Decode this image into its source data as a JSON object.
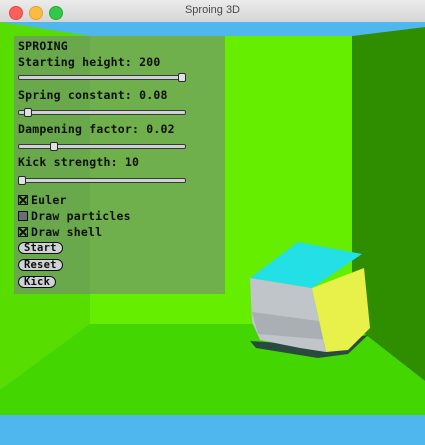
{
  "window": {
    "title": "Sproing 3D"
  },
  "panel": {
    "heading": "SPROING",
    "sliders": [
      {
        "label": "Starting height: 200",
        "fraction": 1.0
      },
      {
        "label": "Spring constant: 0.08",
        "fraction": 0.04
      },
      {
        "label": "Dampening factor: 0.02",
        "fraction": 0.2
      },
      {
        "label": "Kick strength: 10",
        "fraction": 0.0
      }
    ],
    "checkboxes": [
      {
        "label": "Euler",
        "checked": true
      },
      {
        "label": "Draw particles",
        "checked": false
      },
      {
        "label": "Draw shell",
        "checked": true
      }
    ],
    "buttons": {
      "start": "Start",
      "reset": "Reset",
      "kick": "Kick"
    }
  },
  "scene": {
    "floor_color": "#44d600",
    "back_wall_color": "#66ee00",
    "right_wall_color": "#2a8a00",
    "sky_color": "#4fb6ee",
    "cube_top_color": "#22e0e6",
    "cube_side_color": "#e8f04a"
  }
}
